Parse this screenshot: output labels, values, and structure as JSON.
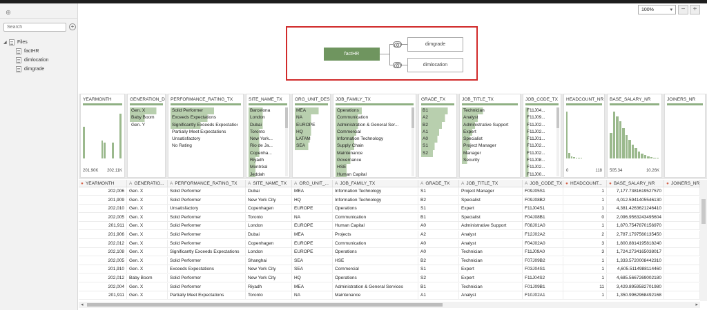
{
  "left_panel": {
    "search_placeholder": "Search",
    "tree": [
      {
        "label": "Files",
        "level": 0
      },
      {
        "label": "factHR",
        "level": 1
      },
      {
        "label": "dimlocation",
        "level": 1
      },
      {
        "label": "dimgrade",
        "level": 1
      }
    ]
  },
  "zoom": {
    "value": "100%"
  },
  "diagram": {
    "fact": "factHR",
    "dims": [
      "dimgrade",
      "dimlocation"
    ]
  },
  "summary_cards": [
    {
      "title": "YEARMONTH",
      "type": "hist",
      "min": "201.90K",
      "max": "202.11K",
      "bars": [
        0.68,
        0.0,
        0.0,
        0.0,
        0.0,
        0.0,
        0.0,
        0.38,
        0.34,
        0.0,
        0.0,
        0.34,
        0.0,
        0.0,
        0.95
      ]
    },
    {
      "title": "GENERATION_D...",
      "type": "list",
      "values": [
        "Gen. X",
        "Baby Boom",
        "Gen. Y"
      ],
      "highlight": [
        0.9,
        0.5,
        0.0
      ]
    },
    {
      "title": "PERFORMANCE_RATING_TX",
      "type": "list",
      "values": [
        "Solid Performer",
        "Exceeds Expectations",
        "Significantly Exceeds Expectations",
        "Partially Meet Expectations",
        "Unsatisfactory",
        "No Rating"
      ],
      "highlight": [
        0.65,
        0.55,
        0.45,
        0.0,
        0.0,
        0.0
      ]
    },
    {
      "title": "SITE_NAME_TX",
      "type": "list",
      "values": [
        "Barcelona",
        "London",
        "Dubai",
        "Toronto",
        "New York...",
        "Rio de Ja...",
        "Copenha...",
        "Riyadh",
        "Montréal",
        "Jeddah"
      ],
      "highlight": [
        0.4,
        0.4,
        0.4,
        0.3,
        0.3,
        0.3,
        0.3,
        0.2,
        0.2,
        0.2
      ]
    },
    {
      "title": "ORG_UNIT_DES...",
      "type": "list",
      "values": [
        "MEA",
        "NA",
        "EUROPE",
        "HQ",
        "LATAM",
        "SEA"
      ],
      "highlight": [
        0.8,
        0.55,
        0.55,
        0.55,
        0.5,
        0.45
      ]
    },
    {
      "title": "JOB_FAMILY_TX",
      "type": "list",
      "values": [
        "Operations",
        "Communication",
        "Administration & General Ser...",
        "Commercial",
        "Information Technology",
        "Supply Chain",
        "Maintenance",
        "Governance",
        "HSE",
        "Human Capital"
      ],
      "highlight": [
        0.35,
        0.3,
        0.3,
        0.28,
        0.25,
        0.25,
        0.2,
        0.2,
        0.15,
        0.15
      ]
    },
    {
      "title": "GRADE_TX",
      "type": "list",
      "values": [
        "B1",
        "A2",
        "B2",
        "A1",
        "A0",
        "S1",
        "S2"
      ],
      "highlight": [
        0.9,
        0.8,
        0.7,
        0.6,
        0.55,
        0.45,
        0.4
      ]
    },
    {
      "title": "JOB_TITLE_TX",
      "type": "list",
      "values": [
        "Technician",
        "Analyst",
        "Administrative Support",
        "Expert",
        "Specialist",
        "Project Manager",
        "Manager",
        "Security"
      ],
      "highlight": [
        0.4,
        0.3,
        0.25,
        0.2,
        0.15,
        0.15,
        0.1,
        0.1
      ]
    },
    {
      "title": "JOB_CODE_TX",
      "type": "list",
      "values": [
        "F11J04...",
        "F11J09...",
        "F11J02...",
        "F11J02...",
        "F11J01...",
        "F11J02...",
        "F11J02...",
        "F11J08...",
        "F11J02...",
        "F11J00..."
      ],
      "highlight": [
        0.1,
        0.1,
        0.1,
        0.1,
        0.1,
        0.1,
        0.1,
        0.1,
        0.1,
        0.1
      ]
    },
    {
      "title": "HEADCOUNT_NR",
      "type": "hist",
      "min": "0",
      "max": "118",
      "bars": [
        1.0,
        0.12,
        0.05,
        0.03,
        0.02,
        0.01,
        0.01,
        0.0,
        0.0,
        0.0,
        0.0,
        0.0,
        0.0,
        0.0,
        0.0
      ]
    },
    {
      "title": "BASE_SALARY_NR",
      "type": "hist",
      "min": "505.34",
      "max": "10.26K",
      "bars": [
        0.55,
        1.0,
        0.9,
        0.8,
        0.65,
        0.5,
        0.4,
        0.3,
        0.22,
        0.15,
        0.1,
        0.07,
        0.05,
        0.03,
        0.02,
        0.01
      ]
    },
    {
      "title": "JOINERS_NR",
      "type": "hist",
      "min": "",
      "max": "",
      "bars": []
    }
  ],
  "table": {
    "columns": [
      {
        "label": "YEARMONTH",
        "type": "num"
      },
      {
        "label": "GENERATIO...",
        "type": "text"
      },
      {
        "label": "PERFORMANCE_RATING_TX",
        "type": "text"
      },
      {
        "label": "SITE_NAME_TX",
        "type": "text"
      },
      {
        "label": "ORG_UNIT_...",
        "type": "text"
      },
      {
        "label": "JOB_FAMILY_TX",
        "type": "text"
      },
      {
        "label": "GRADE_TX",
        "type": "text"
      },
      {
        "label": "JOB_TITLE_TX",
        "type": "text"
      },
      {
        "label": "JOB_CODE_TX",
        "type": "text"
      },
      {
        "label": "HEADCOUNT...",
        "type": "num"
      },
      {
        "label": "BASE_SALARY_NR",
        "type": "num"
      },
      {
        "label": "JOINERS_NR",
        "type": "num"
      }
    ],
    "rows": [
      [
        "202,006",
        "Gen. X",
        "Solid Performer",
        "Dubai",
        "MEA",
        "Information Technology",
        "S1",
        "Project Manager",
        "F09J05S1",
        "1",
        "7,177.7381619527570",
        ""
      ],
      [
        "201,909",
        "Gen. X",
        "Solid Performer",
        "New York City",
        "HQ",
        "Information Technology",
        "B2",
        "Specialist",
        "F09J08B2",
        "1",
        "4,012.5941405546130",
        ""
      ],
      [
        "202,010",
        "Gen. X",
        "Unsatisfactory",
        "Copenhagen",
        "EUROPE",
        "Operations",
        "S1",
        "Expert",
        "F11J04S1",
        "1",
        "4,381.4263621246410",
        ""
      ],
      [
        "202,005",
        "Gen. X",
        "Solid Performer",
        "Toronto",
        "NA",
        "Communication",
        "B1",
        "Specialist",
        "F04J08B1",
        "0",
        "2,096.9563243495604",
        ""
      ],
      [
        "201,911",
        "Gen. X",
        "Solid Performer",
        "London",
        "EUROPE",
        "Human Capital",
        "A0",
        "Administrative Support",
        "F08J01A0",
        "1",
        "1,870.7547870156970",
        ""
      ],
      [
        "201,906",
        "Gen. X",
        "Solid Performer",
        "Dubai",
        "MEA",
        "Projects",
        "A2",
        "Analyst",
        "F12J02A2",
        "2",
        "2,787.1797560135450",
        ""
      ],
      [
        "202,012",
        "Gen. X",
        "Solid Performer",
        "Copenhagen",
        "EUROPE",
        "Communication",
        "A0",
        "Analyst",
        "F04J02A0",
        "3",
        "1,800.8814195818240",
        ""
      ],
      [
        "202,108",
        "Gen. X",
        "Significantly Exceeds Expectations",
        "London",
        "EUROPE",
        "Operations",
        "A0",
        "Technician",
        "F11J09A0",
        "3",
        "1,724.2734165038017",
        ""
      ],
      [
        "202,005",
        "Gen. X",
        "Solid Performer",
        "Shanghai",
        "SEA",
        "HSE",
        "B2",
        "Technician",
        "F07J09B2",
        "1",
        "1,333.5720008442310",
        ""
      ],
      [
        "201,910",
        "Gen. X",
        "Exceeds Expectations",
        "New York City",
        "SEA",
        "Commercial",
        "S1",
        "Expert",
        "F03J04S1",
        "1",
        "4,605.5114988114460",
        ""
      ],
      [
        "202,012",
        "Baby Boom",
        "Solid Performer",
        "New York City",
        "HQ",
        "Operations",
        "S2",
        "Expert",
        "F11J04S2",
        "1",
        "4,685.5667269002180",
        ""
      ],
      [
        "202,004",
        "Gen. X",
        "Solid Performer",
        "Riyadh",
        "MEA",
        "Administration & General Services",
        "B1",
        "Technician",
        "F01J09B1",
        "11",
        "3,429.8959582701980",
        ""
      ],
      [
        "201,911",
        "Gen. X",
        "Partially Meet Expectations",
        "Toronto",
        "NA",
        "Maintenance",
        "A1",
        "Analyst",
        "F10J02A1",
        "1",
        "1,350.9962968492168",
        ""
      ]
    ]
  }
}
